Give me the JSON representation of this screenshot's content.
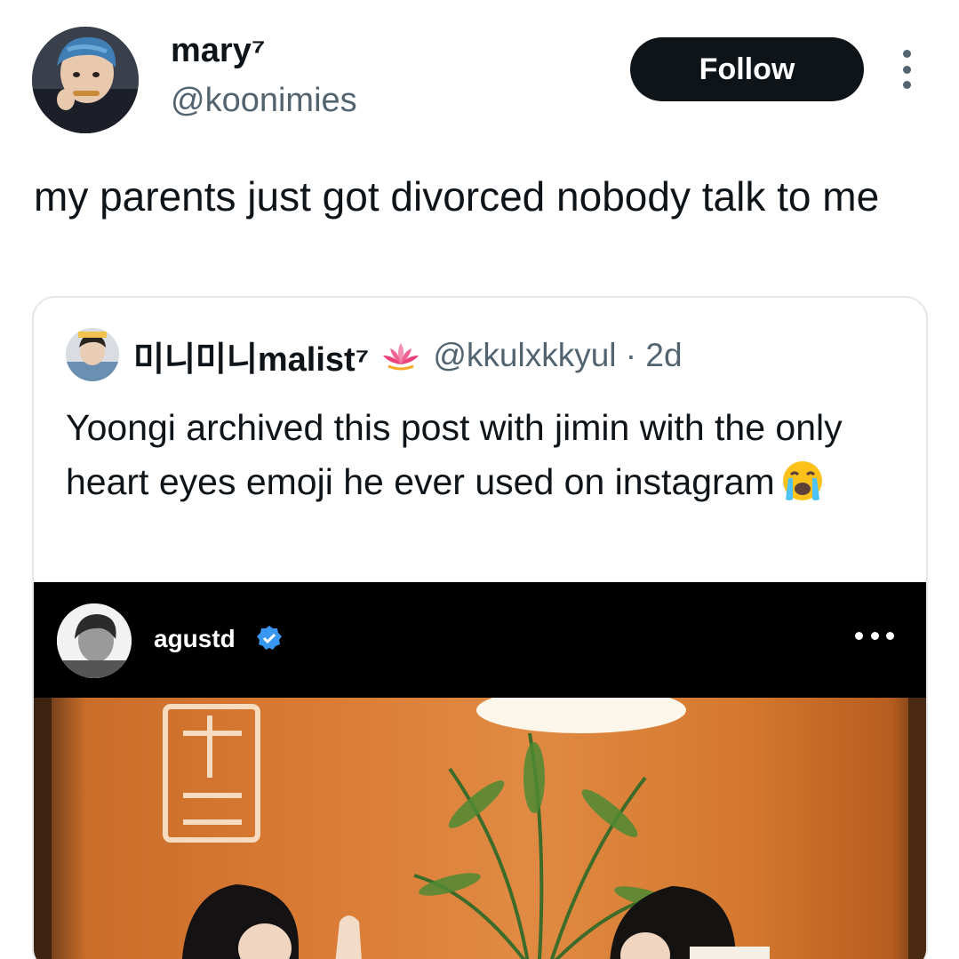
{
  "author": {
    "display_name": "mary⁷",
    "handle": "@koonimies"
  },
  "follow_button": {
    "label": "Follow"
  },
  "tweet": {
    "text": "my parents just got divorced nobody talk to me"
  },
  "quoted": {
    "display_name": "미니미니malist⁷",
    "handle_time": "@kkulxkkyul · 2d",
    "text": "Yoongi archived this post with jimin with the only heart eyes emoji he ever used on instagram",
    "emoji": "loudly-crying-face"
  },
  "embedded_post": {
    "username": "agustd",
    "verified": true
  },
  "colors": {
    "text_primary": "#0f1419",
    "text_secondary": "#536471",
    "follow_bg": "#0f1419",
    "border": "#e3e7ea",
    "verified_blue": "#3897f0",
    "photo_orange": "#d97a34"
  },
  "icons": [
    "more-vertical-icon",
    "lotus-emoji-icon",
    "crying-face-emoji-icon",
    "verified-badge-icon",
    "more-horizontal-icon"
  ]
}
